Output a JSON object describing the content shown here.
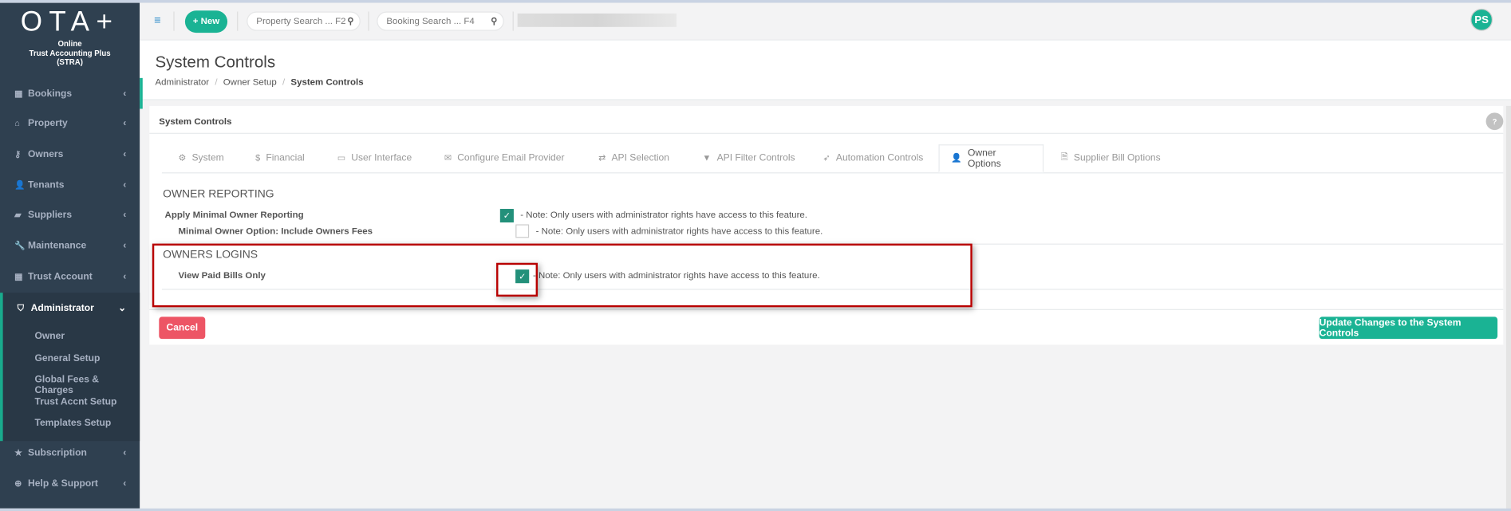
{
  "sidebar": {
    "logo": "OTA+",
    "logo_sub": [
      "Online",
      "Trust Accounting Plus",
      "(STRA)"
    ],
    "items": [
      {
        "label": "Bookings",
        "icon": "calendar-icon"
      },
      {
        "label": "Property",
        "icon": "home-icon"
      },
      {
        "label": "Owners",
        "icon": "key-icon"
      },
      {
        "label": "Tenants",
        "icon": "user-icon"
      },
      {
        "label": "Suppliers",
        "icon": "truck-icon"
      },
      {
        "label": "Maintenance",
        "icon": "wrench-icon"
      },
      {
        "label": "Trust Account",
        "icon": "calculator-icon"
      }
    ],
    "active": {
      "label": "Administrator",
      "icon": "shield-icon",
      "children": [
        "Owner",
        "General Setup",
        "Global Fees & Charges",
        "Trust Accnt Setup",
        "Templates Setup"
      ]
    },
    "bottom": [
      {
        "label": "Subscription",
        "icon": "star-icon"
      },
      {
        "label": "Help & Support",
        "icon": "life-ring-icon"
      }
    ]
  },
  "topbar": {
    "new_label": "+ New",
    "property_search": "Property Search ... F2",
    "booking_search": "Booking Search ... F4",
    "avatar": "PS"
  },
  "header": {
    "title": "System Controls",
    "breadcrumb": [
      "Administrator",
      "Owner Setup",
      "System Controls"
    ]
  },
  "panel": {
    "title": "System Controls",
    "help": "?",
    "tabs": [
      {
        "label": "System",
        "icon": "⚙"
      },
      {
        "label": "Financial",
        "icon": "$"
      },
      {
        "label": "User Interface",
        "icon": "▭"
      },
      {
        "label": "Configure Email Provider",
        "icon": "✉"
      },
      {
        "label": "API Selection",
        "icon": "⇄"
      },
      {
        "label": "API Filter Controls",
        "icon": "▼"
      },
      {
        "label": "Automation Controls",
        "icon": "➶"
      },
      {
        "label": "Owner Options",
        "icon": "👤"
      },
      {
        "label": "Supplier Bill Options",
        "icon": "🗎"
      }
    ],
    "active_tab": "Owner Options",
    "sections": [
      {
        "title": "OWNER REPORTING",
        "rows": [
          {
            "label": "Apply Minimal Owner Reporting",
            "checked": true,
            "note": "- Note: Only users with administrator rights have access to this feature."
          },
          {
            "label": "Minimal Owner Option: Include Owners Fees",
            "checked": false,
            "note": "- Note: Only users with administrator rights have access to this feature."
          }
        ]
      },
      {
        "title": "OWNERS LOGINS",
        "rows": [
          {
            "label": "View Paid Bills Only",
            "checked": true,
            "note": "- Note: Only users with administrator rights have access to this feature."
          }
        ]
      }
    ],
    "cancel": "Cancel",
    "update": "Update Changes to the System Controls"
  },
  "colors": {
    "accent": "#1ab394",
    "danger": "#ed5565",
    "sidebar": "#2f4050",
    "highlight": "#b80000"
  }
}
